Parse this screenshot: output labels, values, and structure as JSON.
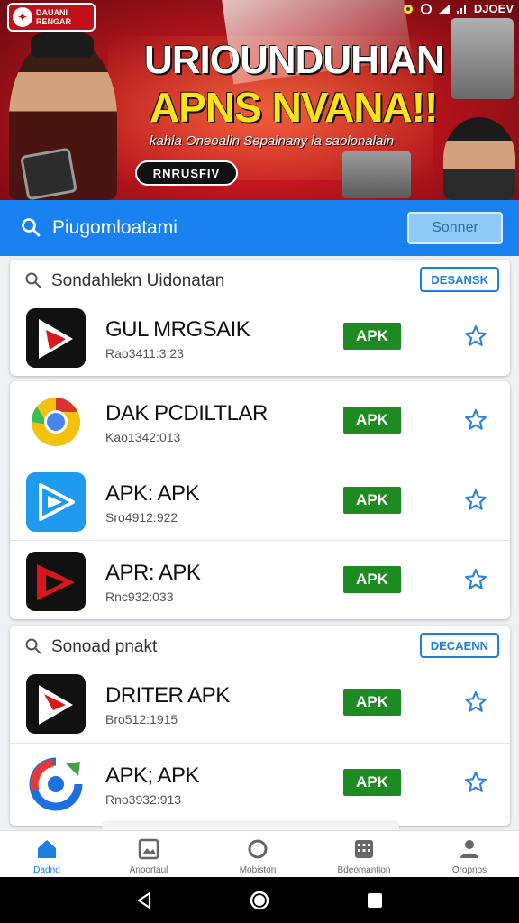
{
  "banner": {
    "logo_text": "DAUANI\nRENGAR",
    "status_time": "DJOEV",
    "title": "URIOUNDUHIAN",
    "subtitle": "APNS NVANA!!",
    "tagline": "kahla Oneoalin Sepalnany la saolonalain",
    "button_label": "RNRUSFIV",
    "colors": {
      "red": "#c0101a",
      "yellow": "#ffe21a"
    }
  },
  "search": {
    "placeholder": "Piugomloatami",
    "button_label": "Sonner",
    "icon": "search-icon"
  },
  "sections": [
    {
      "header": "Sondahlekn Uidonatan",
      "header_button": "DESANSK",
      "apps": [
        {
          "name": "GUL MRGSAIK",
          "meta": "Rao3411:3:23",
          "badge": "APK",
          "icon": "red-play-arrow-icon"
        }
      ]
    },
    {
      "header": "",
      "header_button": "",
      "apps": [
        {
          "name": "DAK PCDILTLAR",
          "meta": "Kao1342:013",
          "badge": "APK",
          "icon": "chrome-like-icon"
        },
        {
          "name": "APK: APK",
          "meta": "Sro4912:922",
          "badge": "APK",
          "icon": "blue-play-icon"
        },
        {
          "name": "APR: APK",
          "meta": "Rnc932:033",
          "badge": "APK",
          "icon": "red-play-arrow-icon"
        }
      ]
    },
    {
      "header": "Sonoad pnakt",
      "header_button": "DECAENN",
      "apps": [
        {
          "name": "DRITER APK",
          "meta": "Bro512:1915",
          "badge": "APK",
          "icon": "red-play-arrow-icon"
        },
        {
          "name": "APK; APK",
          "meta": "Rno3932:913",
          "badge": "APK",
          "icon": "colorful-ring-icon"
        }
      ]
    }
  ],
  "bottom_nav": [
    {
      "label": "Dadno",
      "icon": "home-icon",
      "active": true
    },
    {
      "label": "Anoortaul",
      "icon": "image-icon",
      "active": false
    },
    {
      "label": "Mobiston",
      "icon": "circle-icon",
      "active": false
    },
    {
      "label": "Bdeomantion",
      "icon": "grid-icon",
      "active": false
    },
    {
      "label": "Oropnos",
      "icon": "profile-icon",
      "active": false
    }
  ],
  "system_nav": [
    "back-icon",
    "home-circle-icon",
    "recents-icon"
  ],
  "colors": {
    "accent": "#1a82f0",
    "apk_green": "#1e8a22"
  }
}
